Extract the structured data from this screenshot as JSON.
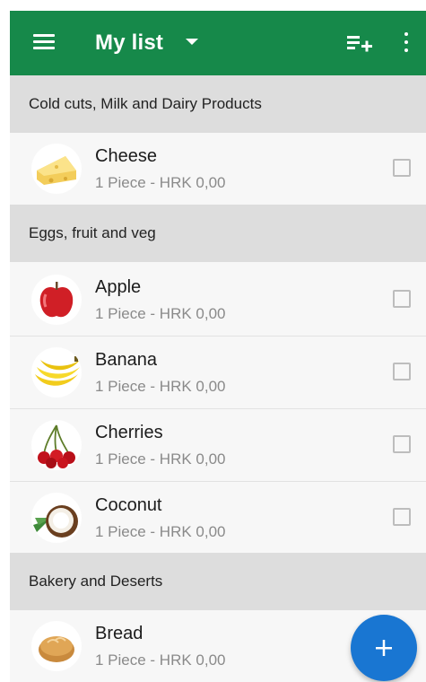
{
  "appbar": {
    "menu_icon": "menu-icon",
    "title": "My list",
    "dropdown_icon": "caret-down-icon",
    "add_list_icon": "playlist-add-icon",
    "more_icon": "more-vertical-icon",
    "color": "#16894a"
  },
  "sections": [
    {
      "label": "Cold cuts, Milk and Dairy Products",
      "items": [
        {
          "name": "Cheese",
          "detail": "1 Piece - HRK 0,00",
          "icon": "cheese-icon"
        }
      ]
    },
    {
      "label": "Eggs, fruit and veg",
      "items": [
        {
          "name": "Apple",
          "detail": "1 Piece - HRK 0,00",
          "icon": "apple-icon"
        },
        {
          "name": "Banana",
          "detail": "1 Piece - HRK 0,00",
          "icon": "banana-icon"
        },
        {
          "name": "Cherries",
          "detail": "1 Piece - HRK 0,00",
          "icon": "cherries-icon"
        },
        {
          "name": "Coconut",
          "detail": "1 Piece - HRK 0,00",
          "icon": "coconut-icon"
        }
      ]
    },
    {
      "label": "Bakery and Deserts",
      "items": [
        {
          "name": "Bread",
          "detail": "1 Piece - HRK 0,00",
          "icon": "bread-icon"
        }
      ]
    }
  ],
  "fab": {
    "icon": "plus-icon",
    "color": "#1976d2"
  }
}
